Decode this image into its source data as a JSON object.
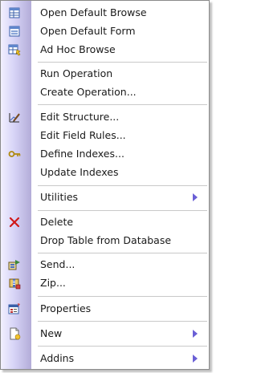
{
  "menu": {
    "open_default_browse": "Open Default Browse",
    "open_default_form": "Open Default Form",
    "ad_hoc_browse": "Ad Hoc Browse",
    "run_operation": "Run Operation",
    "create_operation": "Create Operation...",
    "edit_structure": "Edit Structure...",
    "edit_field_rules": "Edit Field Rules...",
    "define_indexes": "Define Indexes...",
    "update_indexes": "Update Indexes",
    "utilities": "Utilities",
    "delete": "Delete",
    "drop_table": "Drop Table from Database",
    "send": "Send...",
    "zip": "Zip...",
    "properties": "Properties",
    "new": "New",
    "addins": "Addins"
  },
  "colors": {
    "gutter": "#c8c4ee",
    "submenu_arrow": "#6a5fd6",
    "delete_icon": "#d01818"
  }
}
